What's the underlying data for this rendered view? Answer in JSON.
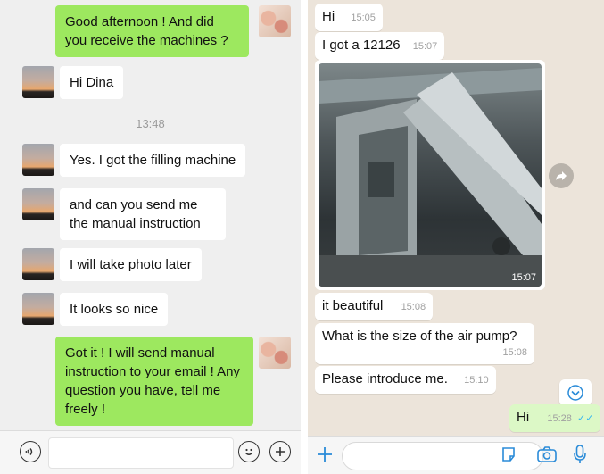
{
  "wechat": {
    "messages": [
      {
        "text": "Good afternoon ! And did you receive the machines ?"
      },
      {
        "text": "Hi Dina"
      },
      {
        "text": "Yes. I got the filling machine"
      },
      {
        "text": "and can you send me the manual instruction"
      },
      {
        "text": "I will take photo later"
      },
      {
        "text": "It looks so nice"
      },
      {
        "text": "Got it ! I will send manual instruction to your email ! Any question you have, tell me freely !"
      }
    ],
    "timestamp": "13:48",
    "bottom_bar": {
      "voice_icon": "voice-icon",
      "emoji_icon": "emoji-icon",
      "add_icon": "plus-icon"
    }
  },
  "whatsapp": {
    "messages": [
      {
        "text": "Hi",
        "time": "15:05"
      },
      {
        "text": "I got a 12126",
        "time": "15:07"
      },
      {
        "image_caption_time": "15:07"
      },
      {
        "text": "it beautiful",
        "time": "15:08"
      },
      {
        "text": "What is the size of the air pump?",
        "time": "15:08"
      },
      {
        "text": "Please introduce me.",
        "time": "15:10"
      },
      {
        "text": "Hi",
        "time": "15:28",
        "status": "read"
      }
    ],
    "bottom_bar": {
      "add_icon": "plus-icon",
      "sticker_icon": "sticker-icon",
      "camera_icon": "camera-icon",
      "mic_icon": "microphone-icon"
    },
    "colors": {
      "outgoing_bubble": "#dcf8c6",
      "tick": "#34b7f1",
      "accent": "#2a8bd8"
    }
  }
}
